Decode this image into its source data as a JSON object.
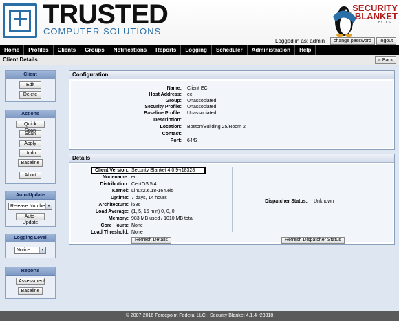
{
  "brand": {
    "title": "TRUSTED",
    "subtitle": "COMPUTER SOLUTIONS",
    "product_line1": "SECURITY",
    "product_line2": "BLANKET",
    "product_by": "BY TCS"
  },
  "session": {
    "logged_in": "Logged in as: admin",
    "change_password": "change password",
    "logout": "logout"
  },
  "nav": [
    "Home",
    "Profiles",
    "Clients",
    "Groups",
    "Notifications",
    "Reports",
    "Logging",
    "Scheduler",
    "Administration",
    "Help"
  ],
  "page": {
    "title": "Client Details",
    "back": "« Back"
  },
  "sidebar": {
    "client": {
      "title": "Client",
      "buttons": [
        "Edit",
        "Delete"
      ]
    },
    "actions": {
      "title": "Actions",
      "buttons": [
        "Quick Scan",
        "Scan",
        "Apply",
        "Undo",
        "Baseline",
        "Abort"
      ]
    },
    "auto_update": {
      "title": "Auto-Update",
      "select_value": "Release Number",
      "button": "Auto-Update"
    },
    "logging_level": {
      "title": "Logging Level",
      "select_value": "Notice"
    },
    "reports": {
      "title": "Reports",
      "buttons": [
        "Assessment",
        "Baseline"
      ]
    }
  },
  "configuration": {
    "title": "Configuration",
    "rows": [
      {
        "label": "Name:",
        "value": "Client EC"
      },
      {
        "label": "Host Address:",
        "value": "ec"
      },
      {
        "label": "Group:",
        "value": "Unassociated"
      },
      {
        "label": "Security Profile:",
        "value": "Unassociated"
      },
      {
        "label": "Baseline Profile:",
        "value": "Unassociated"
      },
      {
        "label": "Description:",
        "value": ""
      },
      {
        "label": "Location:",
        "value": "Boston/Building 25/Room 2"
      },
      {
        "label": "Contact:",
        "value": ""
      },
      {
        "label": "Port:",
        "value": "6443"
      }
    ]
  },
  "details": {
    "title": "Details",
    "rows": [
      {
        "label": "Client Version:",
        "value": "Security Blanket 4.0.9-r18328"
      },
      {
        "label": "Nodename:",
        "value": "ec"
      },
      {
        "label": "Distribution:",
        "value": "CentOS 5.4"
      },
      {
        "label": "Kernel:",
        "value": "Linux2.6.18-164.el5"
      },
      {
        "label": "Uptime:",
        "value": "7 days, 14 hours"
      },
      {
        "label": "Architecture:",
        "value": "i686"
      },
      {
        "label": "Load Average:",
        "value": "(1, 5, 15 min) 0, 0, 0"
      },
      {
        "label": "Memory:",
        "value": "983 MB used / 1010 MB total"
      },
      {
        "label": "Core Hours:",
        "value": "None"
      },
      {
        "label": "Load Threshold:",
        "value": "None"
      }
    ],
    "dispatcher_label": "Dispatcher Status:",
    "dispatcher_value": "Unknown",
    "refresh_details": "Refresh Details",
    "refresh_dispatcher": "Refresh Dispatcher Status"
  },
  "footer": "© 2007-2016 Forcepoint Federal LLC - Security Blanket 4.1.4-r23318"
}
